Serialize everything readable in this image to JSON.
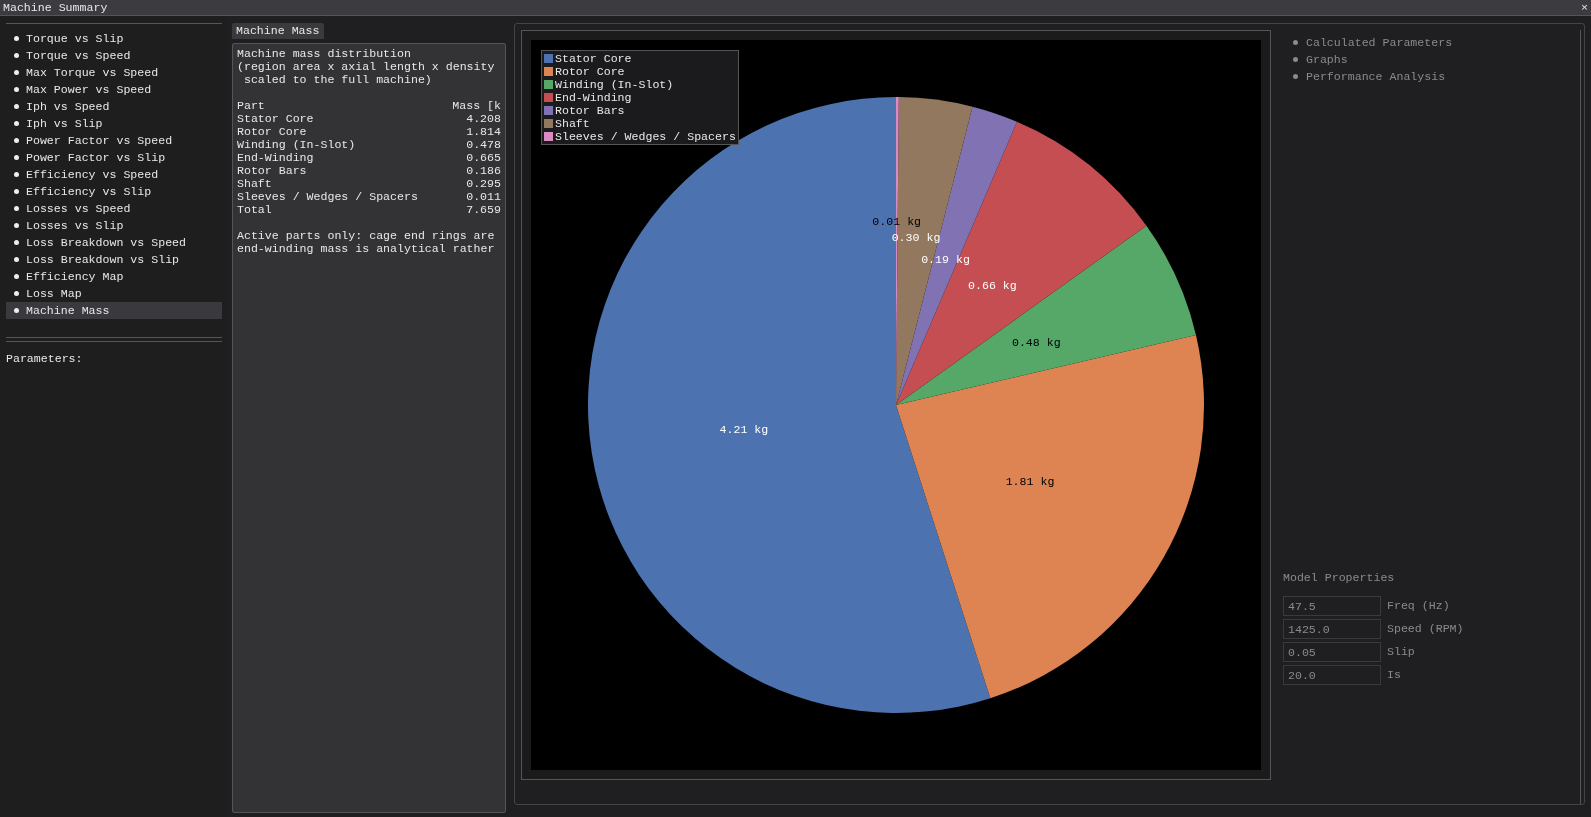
{
  "window": {
    "title": "Machine Summary",
    "close": "×"
  },
  "sidebar": {
    "items": [
      {
        "label": "Torque vs Slip",
        "selected": false
      },
      {
        "label": "Torque vs Speed",
        "selected": false
      },
      {
        "label": "Max Torque vs Speed",
        "selected": false
      },
      {
        "label": "Max Power vs Speed",
        "selected": false
      },
      {
        "label": "Iph vs Speed",
        "selected": false
      },
      {
        "label": "Iph vs Slip",
        "selected": false
      },
      {
        "label": "Power Factor vs Speed",
        "selected": false
      },
      {
        "label": "Power Factor vs Slip",
        "selected": false
      },
      {
        "label": "Efficiency vs Speed",
        "selected": false
      },
      {
        "label": "Efficiency vs Slip",
        "selected": false
      },
      {
        "label": "Losses vs Speed",
        "selected": false
      },
      {
        "label": "Losses vs Slip",
        "selected": false
      },
      {
        "label": "Loss Breakdown vs Speed",
        "selected": false
      },
      {
        "label": "Loss Breakdown vs Slip",
        "selected": false
      },
      {
        "label": "Efficiency Map",
        "selected": false
      },
      {
        "label": "Loss Map",
        "selected": false
      },
      {
        "label": "Machine Mass",
        "selected": true
      }
    ],
    "parameters_label": "Parameters:"
  },
  "mass_panel": {
    "tab": "Machine Mass",
    "description": [
      "Machine mass distribution",
      "(region area x axial length x density",
      " scaled to the full machine)"
    ],
    "columns": [
      "Part",
      "Mass [k"
    ],
    "rows": [
      {
        "part": "Stator Core",
        "mass": "4.208"
      },
      {
        "part": "Rotor Core",
        "mass": "1.814"
      },
      {
        "part": "Winding (In-Slot)",
        "mass": "0.478"
      },
      {
        "part": "End-Winding",
        "mass": "0.665"
      },
      {
        "part": "Rotor Bars",
        "mass": "0.186"
      },
      {
        "part": "Shaft",
        "mass": "0.295"
      },
      {
        "part": "Sleeves / Wedges / Spacers",
        "mass": "0.011"
      },
      {
        "part": "Total",
        "mass": "7.659"
      }
    ],
    "notes": [
      "Active parts only: cage end rings are",
      "end-winding mass is analytical rather"
    ]
  },
  "chart": {
    "chart_data": {
      "type": "pie",
      "categories": [
        "Stator Core",
        "Rotor Core",
        "Winding (In-Slot)",
        "End-Winding",
        "Rotor Bars",
        "Shaft",
        "Sleeves / Wedges / Spacers"
      ],
      "colors": [
        "#4c72b0",
        "#dd8452",
        "#55a868",
        "#c44e52",
        "#8172b3",
        "#937860",
        "#da8bc3"
      ],
      "values": [
        4.208,
        1.814,
        0.478,
        0.665,
        0.186,
        0.295,
        0.011
      ],
      "legend": true,
      "value_labels": [
        "4.21 kg",
        "1.81 kg",
        "0.48 kg",
        "0.66 kg",
        "0.19 kg",
        "0.30 kg",
        "0.01 kg"
      ]
    }
  },
  "background_panel": {
    "items": [
      "Calculated Parameters",
      "Graphs",
      "Performance Analysis"
    ],
    "model_properties": {
      "title": "Model Properties",
      "fields": [
        {
          "value": "47.5",
          "label": "Freq (Hz)"
        },
        {
          "value": "1425.0",
          "label": "Speed (RPM)"
        },
        {
          "value": "0.05",
          "label": "Slip"
        },
        {
          "value": "20.0",
          "label": "Is"
        }
      ]
    }
  }
}
